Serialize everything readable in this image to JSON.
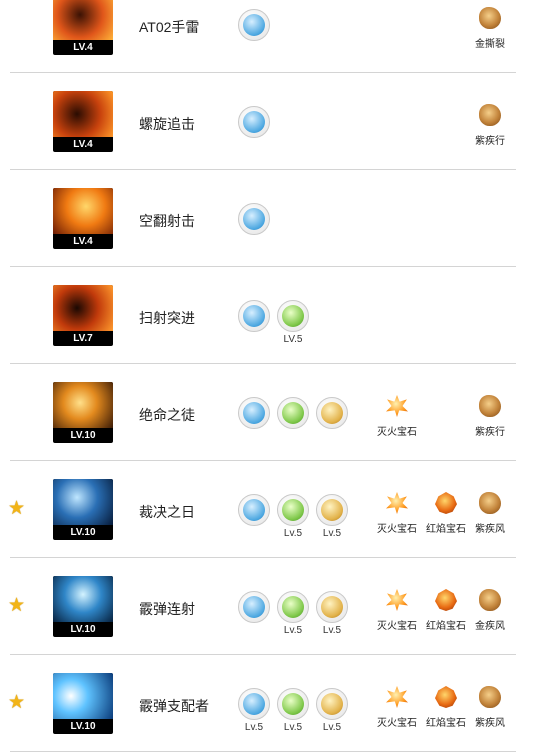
{
  "colors": {
    "star": "#f2b417",
    "divider": "#d4d4d4",
    "skill_bg": "#000000"
  },
  "skills": [
    {
      "name": "AT02手雷",
      "level": "LV.4",
      "starred": false,
      "runes": [
        {
          "icon": "blue-wave-rune-icon",
          "level": ""
        }
      ],
      "gems": [
        {
          "icon": "brown-gem-icon",
          "label": "金撕裂"
        }
      ]
    },
    {
      "name": "螺旋追击",
      "level": "LV.4",
      "starred": false,
      "runes": [
        {
          "icon": "blue-wave-rune-icon",
          "level": ""
        }
      ],
      "gems": [
        {
          "icon": "brown-gem-icon",
          "label": "紫疾行"
        }
      ]
    },
    {
      "name": "空翻射击",
      "level": "LV.4",
      "starred": false,
      "runes": [
        {
          "icon": "blue-tower-rune-icon",
          "level": ""
        }
      ],
      "gems": []
    },
    {
      "name": "扫射突进",
      "level": "LV.7",
      "starred": false,
      "runes": [
        {
          "icon": "blue-tower-rune-icon",
          "level": ""
        },
        {
          "icon": "green-dash-rune-icon",
          "level": "LV.5"
        }
      ],
      "gems": []
    },
    {
      "name": "绝命之徒",
      "level": "LV.10",
      "starred": false,
      "runes": [
        {
          "icon": "blue-swirl-rune-icon",
          "level": ""
        },
        {
          "icon": "green-cross-rune-icon",
          "level": ""
        },
        {
          "icon": "gold-wave-rune-icon",
          "level": ""
        }
      ],
      "gems": [
        {
          "icon": "fire-gem-icon",
          "label": "灭火宝石"
        },
        {
          "icon": "brown-gem-icon",
          "label": "紫疾行"
        }
      ]
    },
    {
      "name": "裁决之日",
      "level": "LV.10",
      "starred": true,
      "runes": [
        {
          "icon": "blue-tower-rune-icon",
          "level": ""
        },
        {
          "icon": "green-flame-rune-icon",
          "level": "Lv.5"
        },
        {
          "icon": "gold-chevron-rune-icon",
          "level": "Lv.5"
        }
      ],
      "gems": [
        {
          "icon": "fire-gem-icon",
          "label": "灭火宝石"
        },
        {
          "icon": "red-flame-gem-icon",
          "label": "红焰宝石"
        },
        {
          "icon": "brown-gem-icon",
          "label": "紫疾风"
        }
      ]
    },
    {
      "name": "霰弹连射",
      "level": "LV.10",
      "starred": true,
      "runes": [
        {
          "icon": "blue-arrow-rune-icon",
          "level": ""
        },
        {
          "icon": "green-gun-rune-icon",
          "level": "Lv.5"
        },
        {
          "icon": "gold-beast-rune-icon",
          "level": "Lv.5"
        }
      ],
      "gems": [
        {
          "icon": "fire-gem-icon",
          "label": "灭火宝石"
        },
        {
          "icon": "red-flame-gem-icon",
          "label": "红焰宝石"
        },
        {
          "icon": "brown-gem-icon",
          "label": "金疾风"
        }
      ]
    },
    {
      "name": "霰弹支配者",
      "level": "LV.10",
      "starred": true,
      "runes": [
        {
          "icon": "blue-gun-rune-icon",
          "level": "Lv.5"
        },
        {
          "icon": "green-beast-rune-icon",
          "level": "Lv.5"
        },
        {
          "icon": "gold-wolf-rune-icon",
          "level": "Lv.5"
        }
      ],
      "gems": [
        {
          "icon": "fire-gem-icon",
          "label": "灭火宝石"
        },
        {
          "icon": "red-flame-gem-icon",
          "label": "红焰宝石"
        },
        {
          "icon": "brown-gem-icon",
          "label": "紫疾风"
        }
      ]
    }
  ]
}
